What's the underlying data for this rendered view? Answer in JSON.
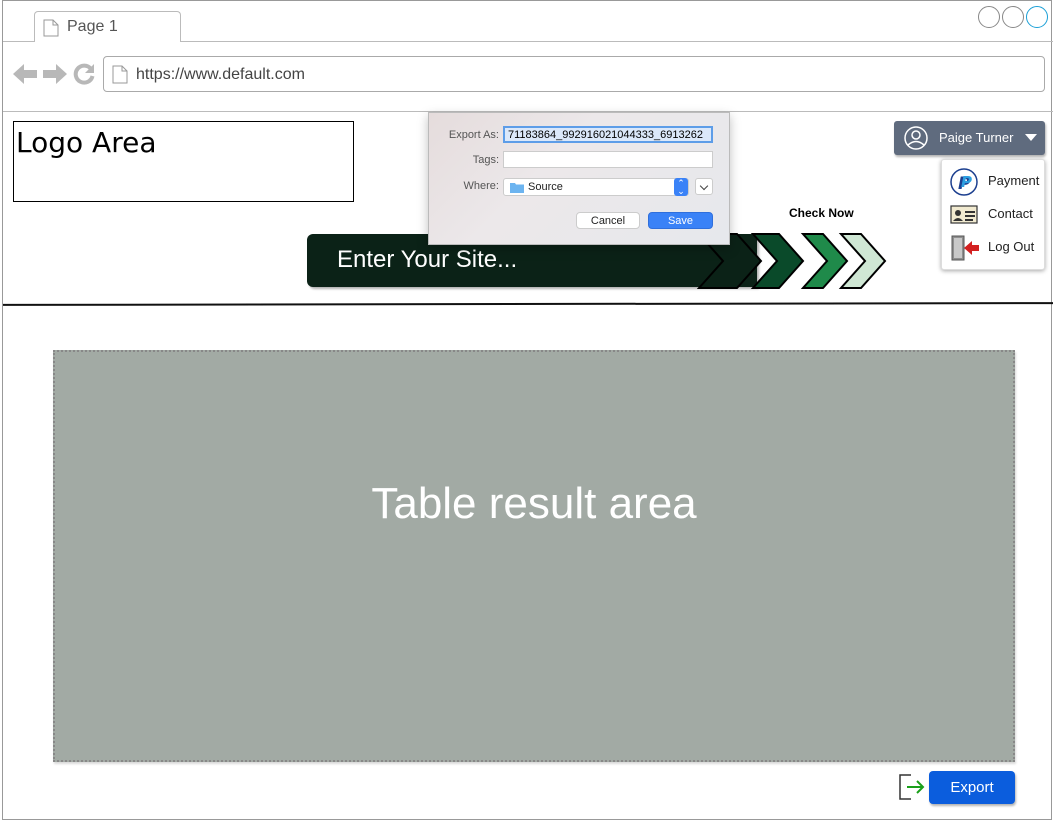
{
  "browser": {
    "tab_label": "Page 1",
    "url": "https://www.default.com"
  },
  "header": {
    "logo_text": "Logo Area",
    "site_input_placeholder": "Enter Your Site...",
    "check_now_label": "Check Now"
  },
  "user_menu": {
    "user_name": "Paige Turner",
    "items": [
      {
        "label": "Payment",
        "icon": "paypal-icon"
      },
      {
        "label": "Contact",
        "icon": "contact-card-icon"
      },
      {
        "label": "Log Out",
        "icon": "logout-door-icon"
      }
    ]
  },
  "save_dialog": {
    "export_as_label": "Export As:",
    "export_as_value": "71183864_992916021044333_6913262",
    "tags_label": "Tags:",
    "tags_value": "",
    "where_label": "Where:",
    "where_value": "Source",
    "cancel_label": "Cancel",
    "save_label": "Save"
  },
  "main": {
    "table_placeholder": "Table result area"
  },
  "footer": {
    "export_label": "Export"
  },
  "colors": {
    "banner_dark": "#0b2217",
    "chevron_1": "#0b2217",
    "chevron_2": "#0a4a2a",
    "chevron_3": "#1f8a4a",
    "chevron_4": "#cfe7d4",
    "user_button": "#5f6b7e",
    "table_area": "#a2aaa4",
    "export_button": "#0b5ddd",
    "dialog_save": "#3a82f7"
  }
}
